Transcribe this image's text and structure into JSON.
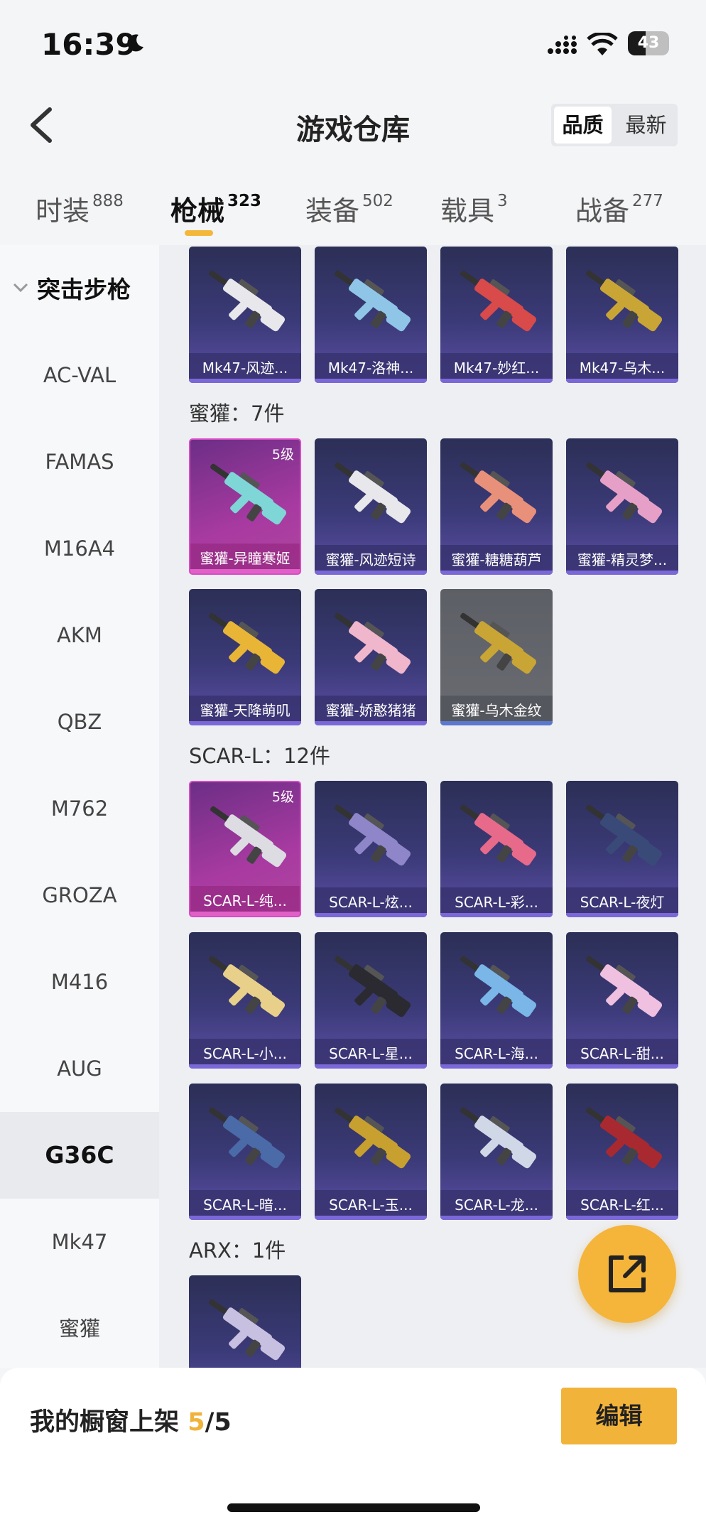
{
  "status": {
    "time": "16:39",
    "battery": "43",
    "battery_level": 0.43
  },
  "header": {
    "title": "游戏仓库",
    "sort_options": [
      "品质",
      "最新"
    ],
    "sort_selected": "品质"
  },
  "tabs": [
    {
      "label": "时装",
      "count": "888"
    },
    {
      "label": "枪械",
      "count": "323"
    },
    {
      "label": "装备",
      "count": "502"
    },
    {
      "label": "载具",
      "count": "3"
    },
    {
      "label": "战备",
      "count": "277"
    }
  ],
  "active_tab": "枪械",
  "sidebar": {
    "category": "突击步枪",
    "items": [
      "AC-VAL",
      "FAMAS",
      "M16A4",
      "AKM",
      "QBZ",
      "M762",
      "GROZA",
      "M416",
      "AUG",
      "G36C",
      "Mk47",
      "蜜獾"
    ],
    "active": "G36C"
  },
  "sections": {
    "mk47": {
      "cards": [
        {
          "label": "Mk47-风迹...",
          "color": "#e8e8ec"
        },
        {
          "label": "Mk47-洛神...",
          "color": "#8fc6e8"
        },
        {
          "label": "Mk47-妙红...",
          "color": "#d94a4a"
        },
        {
          "label": "Mk47-乌木...",
          "color": "#c9a536"
        }
      ]
    },
    "honeybadger": {
      "title": "蜜獾：7件",
      "cards": [
        {
          "label": "蜜獾-异瞳寒姬",
          "level": "5级",
          "color": "#7ed6d6"
        },
        {
          "label": "蜜獾-风迹短诗",
          "color": "#e8e8ec"
        },
        {
          "label": "蜜獾-糖糖葫芦",
          "color": "#e8907a"
        },
        {
          "label": "蜜獾-精灵梦...",
          "color": "#e6a0c8"
        },
        {
          "label": "蜜獾-天降萌叽",
          "color": "#e8b536"
        },
        {
          "label": "蜜獾-娇憨猪猪",
          "color": "#f0b6cc"
        },
        {
          "label": "蜜獾-乌木金纹",
          "color": "#c9a536"
        }
      ]
    },
    "scarl": {
      "title": "SCAR-L：12件",
      "cards": [
        {
          "label": "SCAR-L-纯...",
          "level": "5级",
          "color": "#dcdce2"
        },
        {
          "label": "SCAR-L-炫...",
          "color": "#8e86c8"
        },
        {
          "label": "SCAR-L-彩...",
          "color": "#e86a8a"
        },
        {
          "label": "SCAR-L-夜灯",
          "color": "#3a4a78"
        },
        {
          "label": "SCAR-L-小...",
          "color": "#e8d08a"
        },
        {
          "label": "SCAR-L-星...",
          "color": "#2a2a30"
        },
        {
          "label": "SCAR-L-海...",
          "color": "#7ab6e8"
        },
        {
          "label": "SCAR-L-甜...",
          "color": "#f0c0e0"
        },
        {
          "label": "SCAR-L-暗...",
          "color": "#4a6aa8"
        },
        {
          "label": "SCAR-L-玉...",
          "color": "#c8a030"
        },
        {
          "label": "SCAR-L-龙...",
          "color": "#d0d8e8"
        },
        {
          "label": "SCAR-L-红...",
          "color": "#a82a30"
        }
      ]
    },
    "arx": {
      "title": "ARX：1件",
      "cards": [
        {
          "label": "",
          "color": "#c8c0e0"
        }
      ]
    }
  },
  "showcase": {
    "label": "我的橱窗上架",
    "current": "5",
    "total": "/5"
  },
  "edit_label": "编辑"
}
